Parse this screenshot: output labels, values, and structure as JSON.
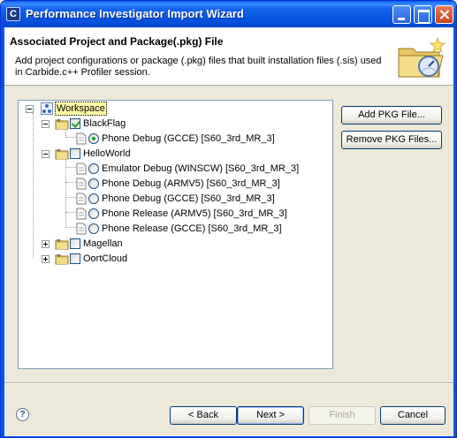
{
  "window": {
    "title": "Performance Investigator Import Wizard",
    "app_icon_letter": "C"
  },
  "header": {
    "title": "Associated Project and Package(.pkg) File",
    "description": "Add project configurations or package (.pkg) files that built installation files (.sis) used in Carbide.c++ Profiler session."
  },
  "tree": {
    "root": {
      "label": "Workspace",
      "expanded": true,
      "selected": true
    },
    "projects": [
      {
        "label": "BlackFlag",
        "expanded": true,
        "checked": true,
        "configs": [
          {
            "label": "Phone Debug (GCCE) [S60_3rd_MR_3]",
            "selected": true
          }
        ]
      },
      {
        "label": "HelloWorld",
        "expanded": true,
        "checked": false,
        "configs": [
          {
            "label": "Emulator Debug (WINSCW) [S60_3rd_MR_3]",
            "selected": false
          },
          {
            "label": "Phone Debug (ARMV5) [S60_3rd_MR_3]",
            "selected": false
          },
          {
            "label": "Phone Debug (GCCE) [S60_3rd_MR_3]",
            "selected": false
          },
          {
            "label": "Phone Release (ARMV5) [S60_3rd_MR_3]",
            "selected": false
          },
          {
            "label": "Phone Release (GCCE) [S60_3rd_MR_3]",
            "selected": false
          }
        ]
      },
      {
        "label": "Magellan",
        "expanded": false,
        "checked": false,
        "configs": []
      },
      {
        "label": "OortCloud",
        "expanded": false,
        "checked": false,
        "configs": []
      }
    ]
  },
  "side_buttons": {
    "add_pkg": "Add PKG File...",
    "remove_pkg": "Remove PKG Files..."
  },
  "footer": {
    "help_glyph": "?",
    "back": "< Back",
    "next": "Next >",
    "finish": "Finish",
    "cancel": "Cancel"
  },
  "colors": {
    "titlebar": "#0554e2",
    "selection": "#fff8a8",
    "check": "#21a121"
  }
}
